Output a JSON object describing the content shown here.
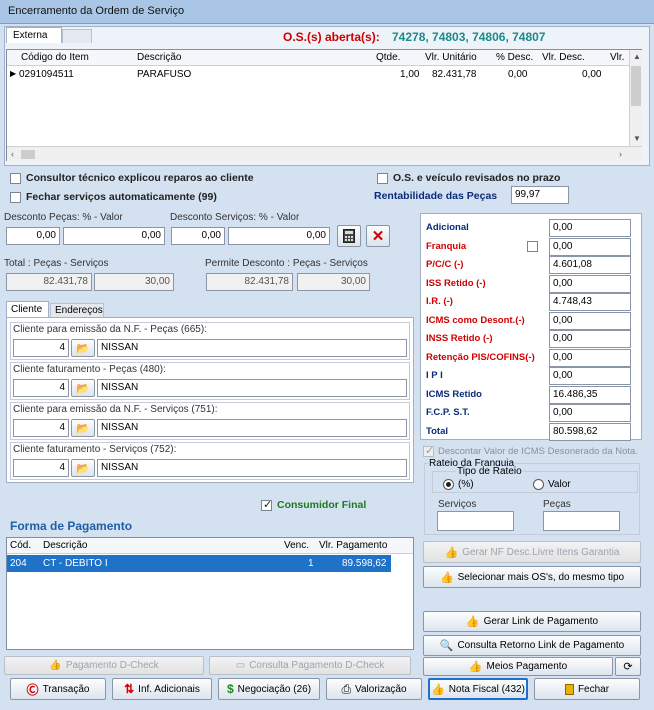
{
  "window": {
    "title": "Encerramento da Ordem de Serviço"
  },
  "tabs_top": [
    "Externa",
    ""
  ],
  "os_open_label": "O.S.(s) aberta(s):",
  "os_open_numbers": "74278, 74803, 74806, 74807",
  "items_table": {
    "headers": [
      "Código do Item",
      "Descrição",
      "Qtde.",
      "Vlr. Unitário",
      "% Desc.",
      "Vlr. Desc.",
      "Vlr."
    ],
    "rows": [
      {
        "codigo": "0291094511",
        "descricao": "PARAFUSO",
        "qtde": "1,00",
        "vlr_unitario": "82.431,78",
        "pct_desc": "0,00",
        "vlr_desc": "0,00"
      }
    ]
  },
  "checks": {
    "consultor": "Consultor técnico explicou reparos ao cliente",
    "os_veiculo": "O.S. e veículo revisados no prazo",
    "fechar": "Fechar serviços automaticamente (99)"
  },
  "rentabilidade": {
    "label": "Rentabilidade das Peças",
    "value": "99,97"
  },
  "desconto": {
    "pecas_label": "Desconto Peças: % - Valor",
    "pecas_pct": "0,00",
    "pecas_valor": "0,00",
    "servicos_label": "Desconto Serviços: % - Valor",
    "servicos_pct": "0,00",
    "servicos_valor": "0,00"
  },
  "totais": {
    "total_label": "Total : Peças - Serviços",
    "total_pecas": "82.431,78",
    "total_servicos": "30,00",
    "permite_label": "Permite Desconto : Peças - Serviços",
    "permite_pecas": "82.431,78",
    "permite_servicos": "30,00"
  },
  "tabs_cliente": [
    "Cliente",
    "Endereços"
  ],
  "clientes": [
    {
      "label": "Cliente para emissão da N.F. - Peças (665):",
      "code": "4",
      "name": "NISSAN"
    },
    {
      "label": "Cliente faturamento - Peças (480):",
      "code": "4",
      "name": "NISSAN"
    },
    {
      "label": "Cliente para emissão da N.F. - Serviços (751):",
      "code": "4",
      "name": "NISSAN"
    },
    {
      "label": "Cliente faturamento - Serviços (752):",
      "code": "4",
      "name": "NISSAN"
    }
  ],
  "consumidor_final": "Consumidor Final",
  "impostos": [
    {
      "label": "Adicional",
      "value": "0,00",
      "color": "navy"
    },
    {
      "label": "Franquia",
      "value": "0,00",
      "color": "red"
    },
    {
      "label": "P/C/C (-)",
      "value": "4.601,08",
      "color": "red"
    },
    {
      "label": "ISS Retido (-)",
      "value": "0,00",
      "color": "red"
    },
    {
      "label": "I.R. (-)",
      "value": "4.748,43",
      "color": "red"
    },
    {
      "label": "ICMS como Desont.(-)",
      "value": "0,00",
      "color": "red"
    },
    {
      "label": "INSS Retido (-)",
      "value": "0,00",
      "color": "red"
    },
    {
      "label": "Retenção PIS/COFINS(-)",
      "value": "0,00",
      "color": "red"
    },
    {
      "label": "I P I",
      "value": "0,00",
      "color": "navy"
    },
    {
      "label": "ICMS Retido",
      "value": "16.486,35",
      "color": "navy"
    },
    {
      "label": "F.C.P. S.T.",
      "value": "0,00",
      "color": "navy"
    },
    {
      "label": "Total",
      "value": "80.598,62",
      "color": "navy"
    }
  ],
  "descontar_icms": "Descontar Valor de ICMS Desonerado da Nota.",
  "rateio": {
    "group_label": "Rateio da Franquia",
    "tipo_label": "Tipo de Rateio",
    "opt_pct": "(%)",
    "opt_valor": "Valor",
    "servicos_label": "Serviços",
    "pecas_label": "Peças"
  },
  "pagamento": {
    "title": "Forma de Pagamento",
    "headers": [
      "Cód.",
      "Descrição",
      "Venc.",
      "Vlr. Pagamento"
    ],
    "rows": [
      {
        "cod": "204",
        "descricao": "CT - DEBITO I",
        "venc": "1",
        "valor": "89.598,62"
      }
    ]
  },
  "right_buttons": {
    "gerar_nf": "Gerar NF Desc.Livre Itens Garantia",
    "selecionar": "Selecionar mais OS's, do mesmo tipo",
    "gerar_link": "Gerar Link de Pagamento",
    "consulta_link": "Consulta Retorno Link de Pagamento",
    "meios": "Meios Pagamento"
  },
  "mid_buttons": {
    "pag_dcheck": "Pagamento D-Check",
    "consulta_dcheck": "Consulta Pagamento D-Check"
  },
  "bottom_buttons": [
    "Transação",
    "Inf. Adicionais",
    "Negociação (26)",
    "Valorização",
    "Nota Fiscal (432)",
    "Fechar"
  ],
  "colors": {
    "accent": "#d10000",
    "navy": "#0b2a7a",
    "selection": "#1e72c8"
  }
}
